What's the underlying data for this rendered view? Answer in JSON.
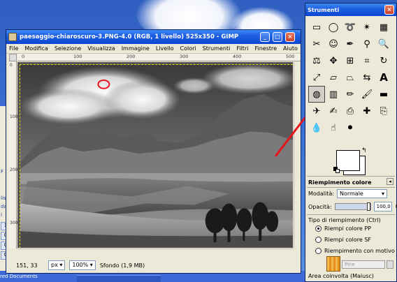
{
  "gimp_window": {
    "title": "paesaggio-chiaroscuro-3.PNG-4.0 (RGB, 1 livello) 525x350 - GIMP",
    "menu": [
      "File",
      "Modifica",
      "Selezione",
      "Visualizza",
      "Immagine",
      "Livello",
      "Colori",
      "Strumenti",
      "Filtri",
      "Finestre",
      "Aiuto"
    ],
    "ruler_marks": [
      "0",
      "100",
      "200",
      "300",
      "400",
      "500"
    ],
    "ruler_left_marks": [
      "0",
      "100",
      "200",
      "300"
    ],
    "status": {
      "coords": "151, 33",
      "unit": "px",
      "zoom": "100%",
      "info": "Sfondo (1,9 MB)"
    }
  },
  "toolbox": {
    "title": "Strumenti",
    "options_title": "Riempimento colore",
    "mode_label": "Modalità:",
    "mode_value": "Normale",
    "opacity_label": "Opacità:",
    "opacity_value": "100,0",
    "opacity_fraction": 1.0,
    "fill_type_label": "Tipo di riempimento (Ctrl)",
    "fill_options": [
      "Riempi colore PP",
      "Riempi colore SF",
      "Riempimento con motivo"
    ],
    "fill_selected": 0,
    "pattern_name": "Pine",
    "area_label": "Area coinvolta (Maiusc)"
  },
  "background_window": {
    "labels": [
      "F",
      "list",
      "da",
      "i"
    ],
    "numbers": [
      "1",
      "0",
      "0",
      "0"
    ]
  },
  "taskbar": {
    "doc_label": "red Documents"
  },
  "annotation_color": "#e8141c"
}
